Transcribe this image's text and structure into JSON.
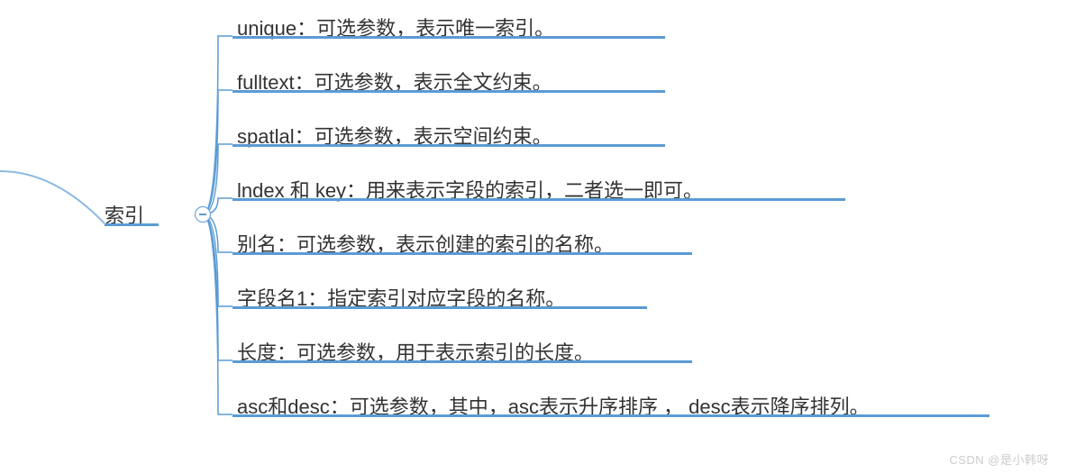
{
  "root": {
    "label": "索引"
  },
  "collapse_symbol": "−",
  "children": [
    {
      "text": "unique：可选参数，表示唯一索引。"
    },
    {
      "text": "fulltext：可选参数，表示全文约束。"
    },
    {
      "text": "spatlal：可选参数，表示空间约束。"
    },
    {
      "text": "lndex 和 key：用来表示字段的索引，二者选一即可。"
    },
    {
      "text": "别名：可选参数，表示创建的索引的名称。"
    },
    {
      "text": "字段名1：指定索引对应字段的名称。"
    },
    {
      "text": "长度：可选参数，用于表示索引的长度。"
    },
    {
      "text": "asc和desc：可选参数，其中，asc表示升序排序 ， desc表示降序排列。"
    }
  ],
  "watermark": "CSDN @是小韩呀"
}
